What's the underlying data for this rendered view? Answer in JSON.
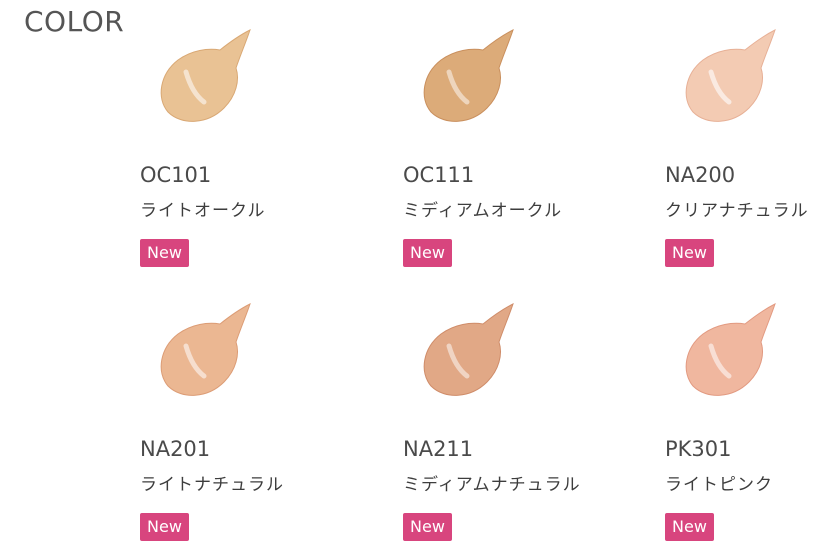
{
  "section": {
    "title": "COLOR"
  },
  "badge_color": "#d8457e",
  "shades": [
    {
      "code": "OC101",
      "name": "ライトオークル",
      "badge": "New",
      "swatch_color": "#e9c294",
      "swatch_shadow": "#d9a874"
    },
    {
      "code": "OC111",
      "name": "ミディアムオークル",
      "badge": "New",
      "swatch_color": "#dcab79",
      "swatch_shadow": "#c98f5d"
    },
    {
      "code": "NA200",
      "name": "クリアナチュラル",
      "badge": "New",
      "swatch_color": "#f3cbb3",
      "swatch_shadow": "#e7b096"
    },
    {
      "code": "NA201",
      "name": "ライトナチュラル",
      "badge": "New",
      "swatch_color": "#ebb792",
      "swatch_shadow": "#dc9c75"
    },
    {
      "code": "NA211",
      "name": "ミディアムナチュラル",
      "badge": "New",
      "swatch_color": "#e1a886",
      "swatch_shadow": "#cf8c69"
    },
    {
      "code": "PK301",
      "name": "ライトピンク",
      "badge": "New",
      "swatch_color": "#f0b79f",
      "swatch_shadow": "#e29a81"
    }
  ]
}
